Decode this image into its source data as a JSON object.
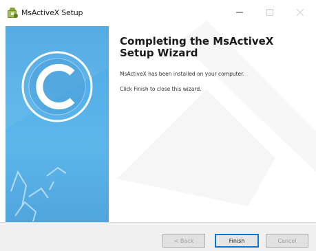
{
  "window": {
    "title": "MsActiveX Setup"
  },
  "titlebar": {
    "minimize_icon": "minimize-icon",
    "maximize_icon": "maximize-icon",
    "close_icon": "close-icon"
  },
  "main": {
    "heading": "Completing the MsActiveX Setup Wizard",
    "line1": "MsActiveX has been installed on your computer.",
    "line2": "Click Finish to close this wizard."
  },
  "buttons": {
    "back": "< Back",
    "finish": "Finish",
    "cancel": "Cancel"
  },
  "colors": {
    "banner": "#4fa9e2",
    "focus": "#0078d7"
  }
}
